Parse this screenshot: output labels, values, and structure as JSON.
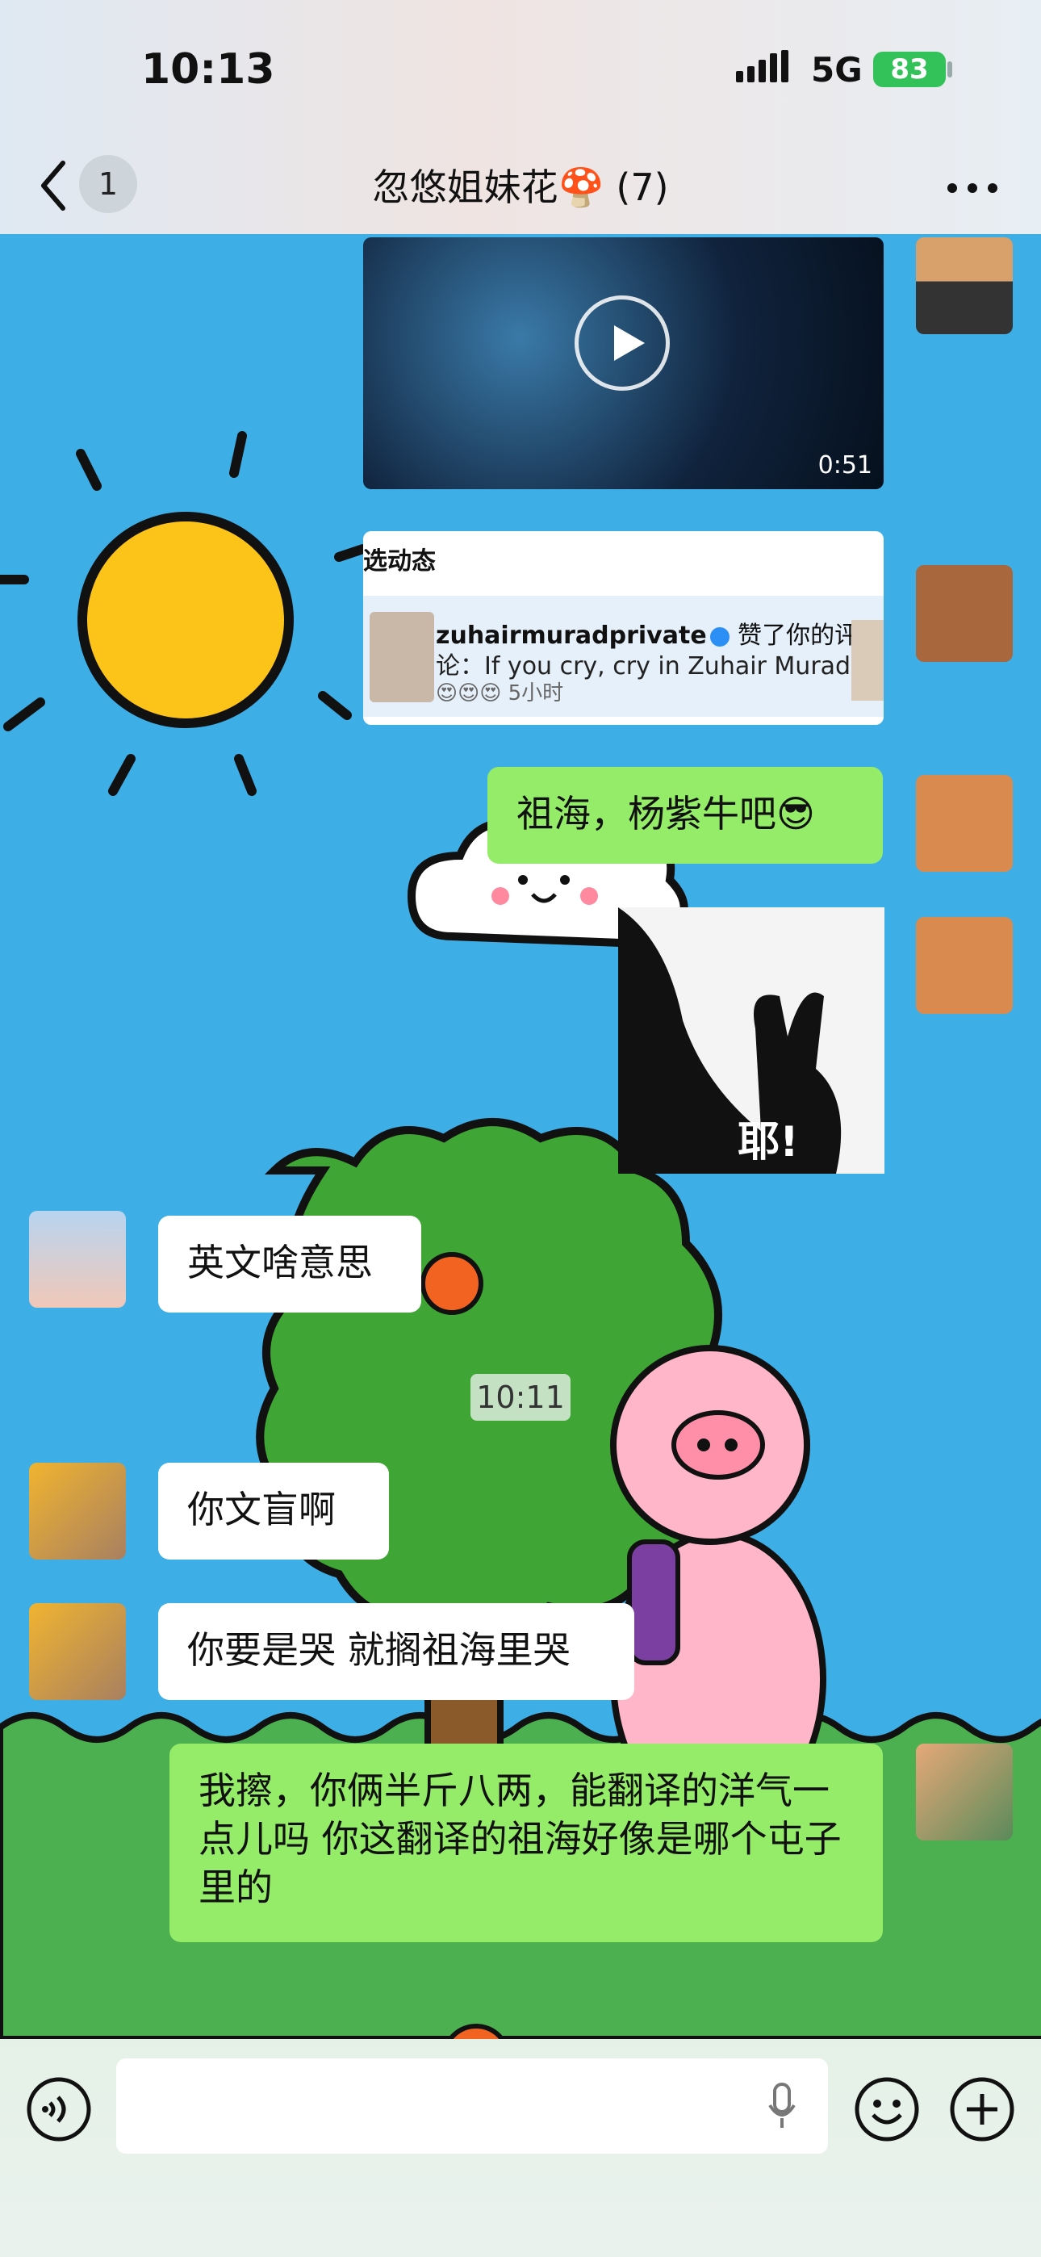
{
  "status": {
    "time": "10:13",
    "network": "5G",
    "battery": "83"
  },
  "nav": {
    "unread_count": "1",
    "title": "忽悠姐妹花🍄 (7)"
  },
  "messages": {
    "video_duration": "0:51",
    "card": {
      "header": "选动态",
      "username": "zuhairmuradprivate",
      "action": "赞了你的评",
      "comment": "论：If you cry, cry in Zuhair Murad",
      "emojis": "😍😍😍",
      "time_ago": "5小时"
    },
    "m1": "祖海，杨紫牛吧😎",
    "sticker_text": "耶!",
    "m2": "英文啥意思",
    "timestamp": "10:11",
    "m3": "你文盲啊",
    "m4": "你要是哭 就搁祖海里哭",
    "m5": "我擦，你俩半斤八两，能翻译的洋气一点儿吗 你这翻译的祖海好像是哪个屯子里的"
  },
  "icons": [
    "back-icon",
    "play-icon",
    "voice-icon",
    "microphone-icon",
    "emoji-icon",
    "plus-icon",
    "more-icon",
    "verified-icon"
  ],
  "colors": {
    "self_bubble": "#95ec69",
    "other_bubble": "#ffffff",
    "wallpaper_sky": "#3daee6",
    "wallpaper_grass": "#4caf50"
  }
}
